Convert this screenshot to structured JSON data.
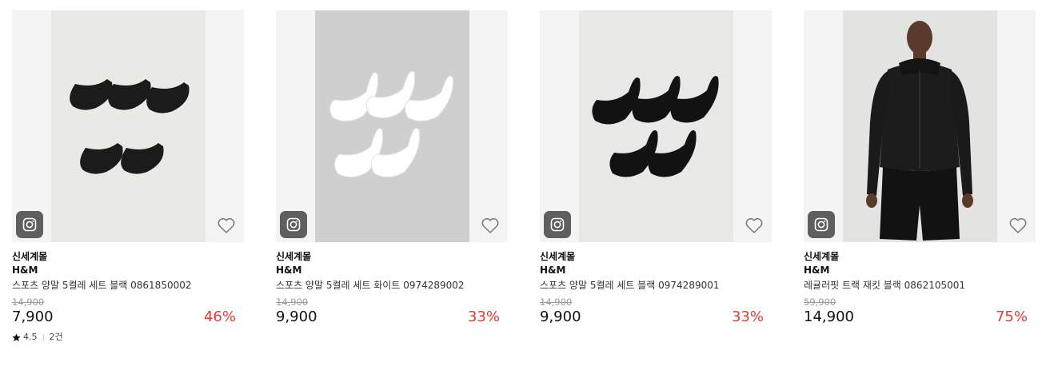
{
  "products": [
    {
      "shop": "신세계몰",
      "brand": "H&M",
      "name": "스포츠 양말 5켤레 세트 블랙 0861850002",
      "original_price": "14,900",
      "price": "7,900",
      "discount": "46%",
      "rating": "4.5",
      "review_count": "2건",
      "image": "black-socks-icon"
    },
    {
      "shop": "신세계몰",
      "brand": "H&M",
      "name": "스포츠 양말 5켤레 세트 화이트 0974289002",
      "original_price": "14,900",
      "price": "9,900",
      "discount": "33%",
      "image": "white-socks-icon"
    },
    {
      "shop": "신세계몰",
      "brand": "H&M",
      "name": "스포츠 양말 5켤레 세트 블랙 0974289001",
      "original_price": "14,900",
      "price": "9,900",
      "discount": "33%",
      "image": "black-socks-icon"
    },
    {
      "shop": "신세계몰",
      "brand": "H&M",
      "name": "레귤러핏 트랙 재킷 블랙 0862105001",
      "original_price": "59,900",
      "price": "14,900",
      "discount": "75%",
      "image": "jacket-model-icon"
    }
  ],
  "colors": {
    "discount": "#e63a30",
    "insta_badge": "#5f5f5f"
  }
}
